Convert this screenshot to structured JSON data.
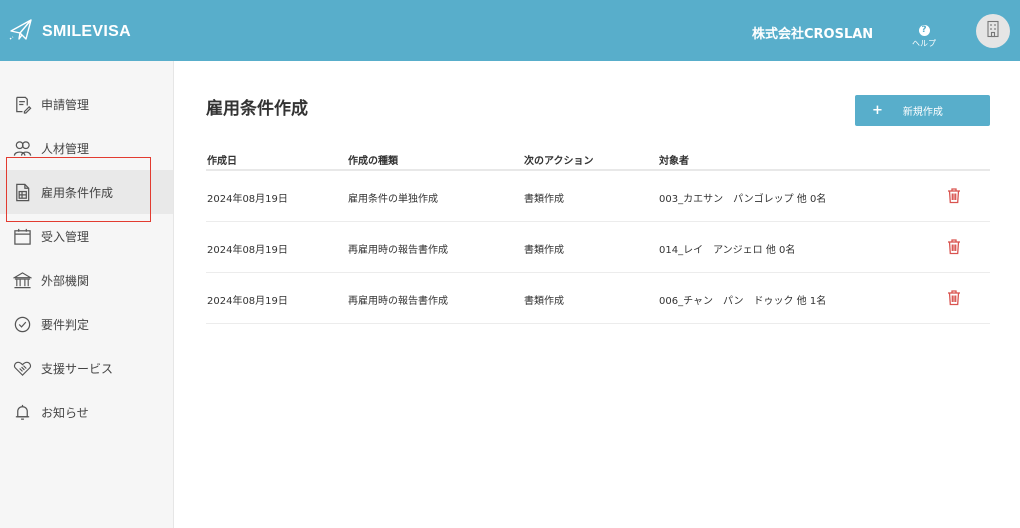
{
  "header": {
    "brand": "SMILEVISA",
    "company": "株式会社CROSLAN",
    "help_label": "ヘルプ",
    "help_icon": "question-circle-icon",
    "avatar_icon": "building-icon",
    "colors": {
      "bar": "#58aecb"
    }
  },
  "sidebar": {
    "items": [
      {
        "label": "申請管理",
        "icon": "document-pencil-icon"
      },
      {
        "label": "人材管理",
        "icon": "people-icon"
      },
      {
        "label": "雇用条件作成",
        "icon": "document-table-icon",
        "active": true
      },
      {
        "label": "受入管理",
        "icon": "calendar-icon"
      },
      {
        "label": "外部機関",
        "icon": "institution-icon"
      },
      {
        "label": "要件判定",
        "icon": "check-circle-icon"
      },
      {
        "label": "支援サービス",
        "icon": "handshake-icon"
      },
      {
        "label": "お知らせ",
        "icon": "bell-icon"
      }
    ],
    "highlight_color": "#e23b30"
  },
  "main": {
    "title": "雇用条件作成",
    "new_button": {
      "plus": "+",
      "label": "新規作成"
    },
    "table": {
      "headers": [
        "作成日",
        "作成の種類",
        "次のアクション",
        "対象者"
      ],
      "rows": [
        [
          "2024年08月19日",
          "雇用条件の単独作成",
          "書類作成",
          "003_カエサン　パンゴレップ 他 0名"
        ],
        [
          "2024年08月19日",
          "再雇用時の報告書作成",
          "書類作成",
          "014_レイ　アンジェロ 他 0名"
        ],
        [
          "2024年08月19日",
          "再雇用時の報告書作成",
          "書類作成",
          "006_チャン　パン　ドゥック 他 1名"
        ]
      ],
      "delete_icon": "trash-icon",
      "delete_color": "#d9534f"
    }
  }
}
